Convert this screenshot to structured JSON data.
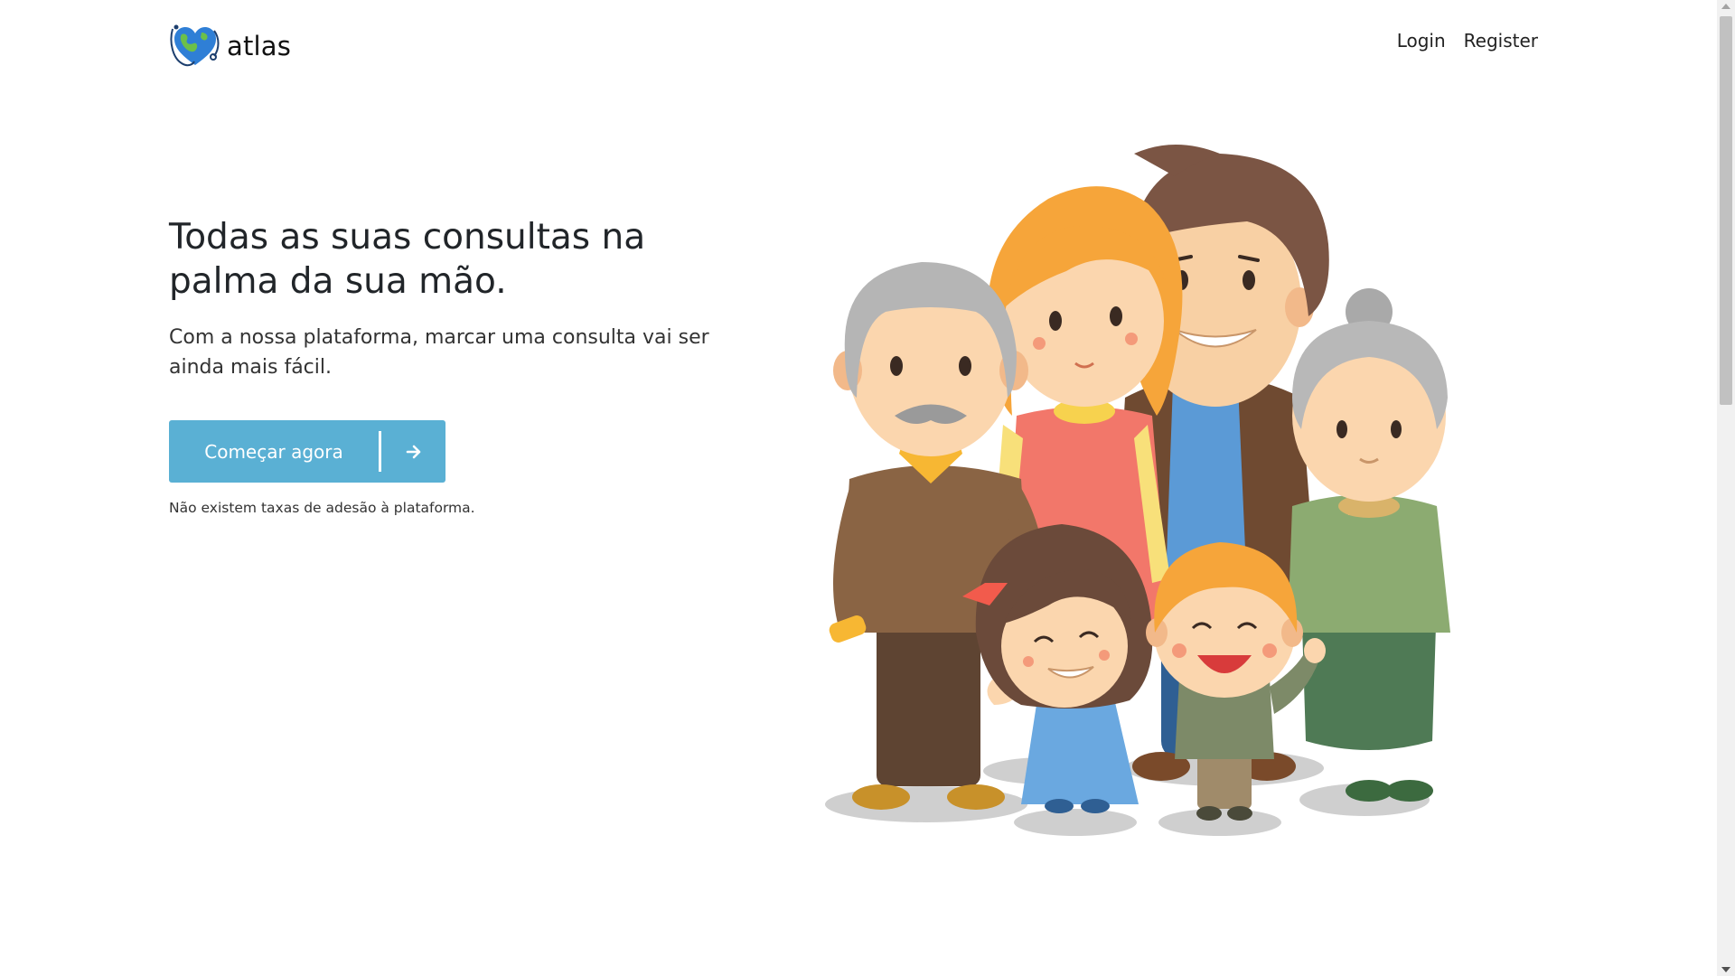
{
  "brand": {
    "name": "atlas",
    "logo_icon": "heart-globe-stethoscope-icon"
  },
  "nav": {
    "login": "Login",
    "register": "Register"
  },
  "hero": {
    "title": "Todas as suas consultas na palma da sua mão.",
    "subtitle": "Com a nossa plataforma, marcar uma consulta vai ser ainda mais fácil.",
    "cta_label": "Começar agora",
    "cta_icon": "arrow-right-icon",
    "note": "Não existem taxas de adesão à plataforma."
  },
  "colors": {
    "accent": "#5ab0d4",
    "text": "#212529",
    "background": "#ffffff"
  },
  "illustration": {
    "icon": "family-illustration"
  }
}
